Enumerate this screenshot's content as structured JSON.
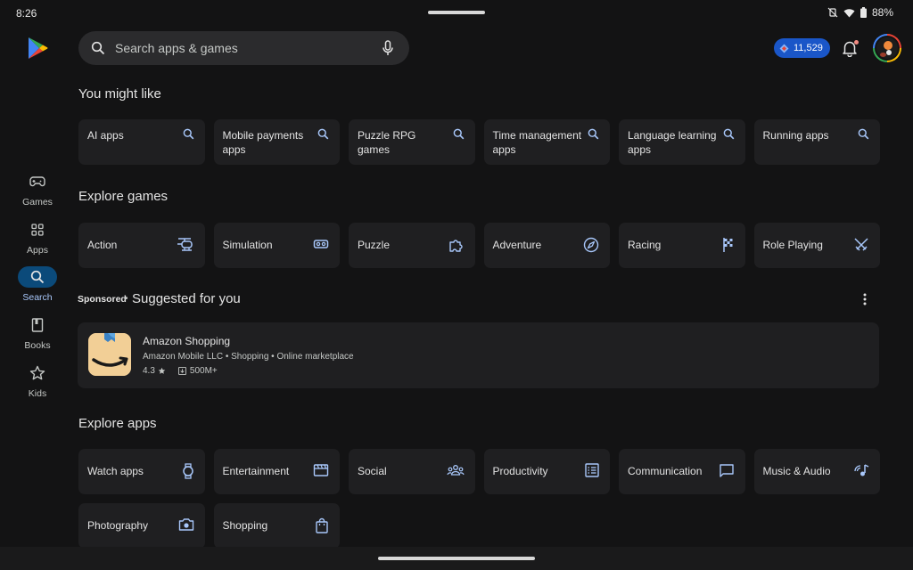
{
  "status": {
    "time": "8:26",
    "battery": "88%"
  },
  "search": {
    "placeholder": "Search apps & games"
  },
  "points": "11,529",
  "rail": [
    {
      "label": "Games",
      "icon": "gamepad-icon"
    },
    {
      "label": "Apps",
      "icon": "apps-grid-icon"
    },
    {
      "label": "Search",
      "icon": "search-icon",
      "active": true
    },
    {
      "label": "Books",
      "icon": "book-icon"
    },
    {
      "label": "Kids",
      "icon": "star-icon"
    }
  ],
  "you_might_like": {
    "title": "You might like",
    "chips": [
      "AI apps",
      "Mobile payments apps",
      "Puzzle RPG games",
      "Time management apps",
      "Language learning apps",
      "Running apps"
    ]
  },
  "explore_games": {
    "title": "Explore games",
    "chips": [
      {
        "label": "Action",
        "icon": "helicopter-icon"
      },
      {
        "label": "Simulation",
        "icon": "vr-headset-icon"
      },
      {
        "label": "Puzzle",
        "icon": "puzzle-piece-icon"
      },
      {
        "label": "Adventure",
        "icon": "compass-icon"
      },
      {
        "label": "Racing",
        "icon": "checkered-flag-icon"
      },
      {
        "label": "Role Playing",
        "icon": "crossed-swords-icon"
      }
    ]
  },
  "suggested": {
    "sponsored": "Sponsored",
    "separator": "•",
    "title": "Suggested for you",
    "app": {
      "name": "Amazon Shopping",
      "developer": "Amazon Mobile LLC",
      "category": "Shopping",
      "subcategory": "Online marketplace",
      "rating": "4.3",
      "downloads": "500M+"
    }
  },
  "explore_apps": {
    "title": "Explore apps",
    "chips": [
      {
        "label": "Watch apps",
        "icon": "watch-icon"
      },
      {
        "label": "Entertainment",
        "icon": "clapperboard-icon"
      },
      {
        "label": "Social",
        "icon": "group-icon"
      },
      {
        "label": "Productivity",
        "icon": "checklist-icon"
      },
      {
        "label": "Communication",
        "icon": "chat-bubble-icon"
      },
      {
        "label": "Music & Audio",
        "icon": "music-note-icon"
      },
      {
        "label": "Photography",
        "icon": "camera-icon"
      },
      {
        "label": "Shopping",
        "icon": "shopping-bag-icon"
      }
    ]
  },
  "colors": {
    "accent": "#a8c7fa",
    "background": "#131314",
    "card": "#1f1f21",
    "points_badge": "#1a56c8"
  }
}
